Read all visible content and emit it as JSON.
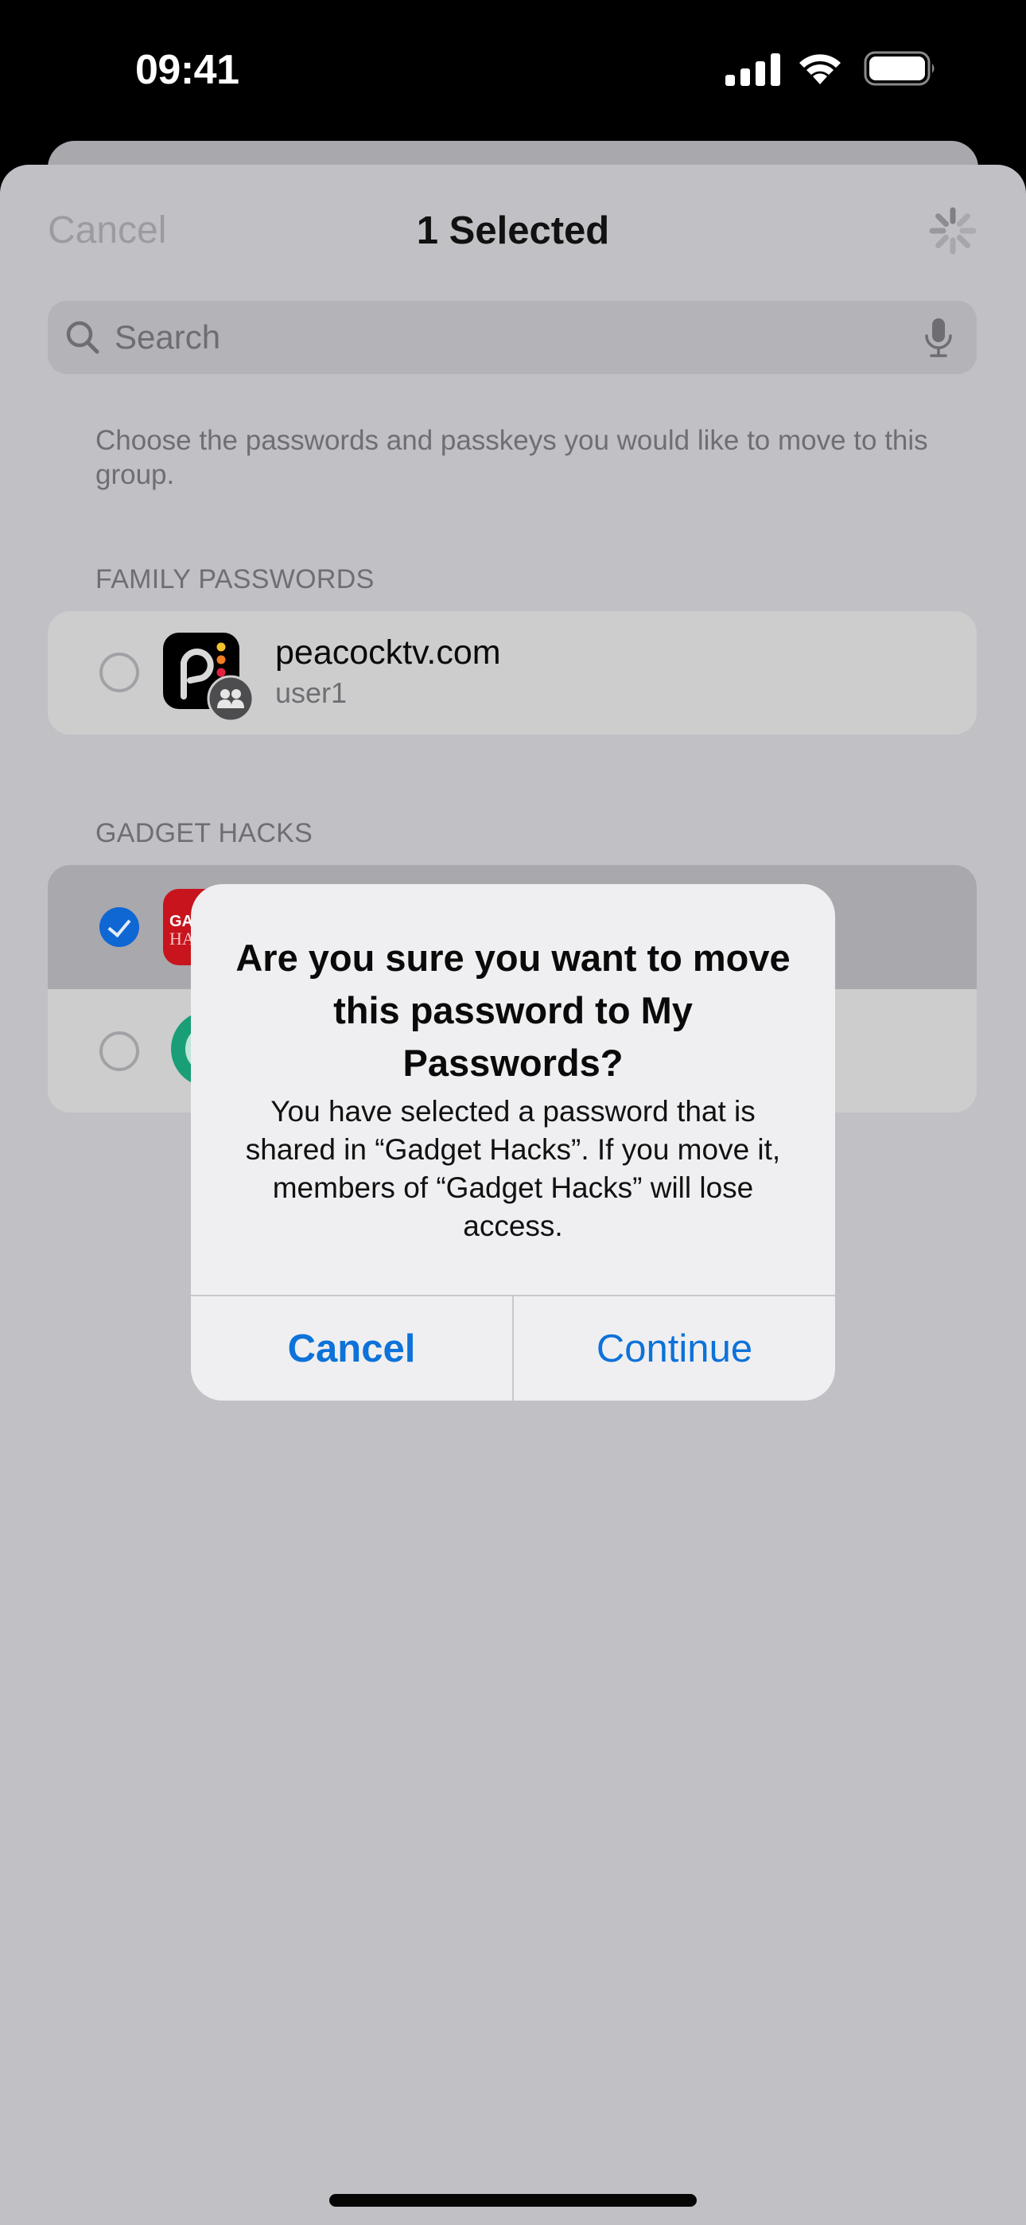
{
  "status_bar": {
    "time": "09:41",
    "icons": [
      "cellular-signal-icon",
      "wifi-icon",
      "battery-icon"
    ]
  },
  "nav": {
    "cancel_label": "Cancel",
    "title": "1 Selected",
    "activity_icon": "loading-spinner-icon"
  },
  "search": {
    "placeholder": "Search",
    "value": "",
    "icon": "search-icon",
    "mic_icon": "microphone-icon"
  },
  "description": "Choose the passwords and passkeys you would like to move to this group.",
  "sections": [
    {
      "header": "FAMILY PASSWORDS",
      "items": [
        {
          "title": "peacocktv.com",
          "subtitle": "user1",
          "selected": false,
          "icon": "peacock-app-icon",
          "badge": "shared-group-icon"
        }
      ]
    },
    {
      "header": "GADGET HACKS",
      "items": [
        {
          "title": "",
          "subtitle": "",
          "selected": true,
          "icon": "gadget-hacks-app-icon",
          "icon_text": [
            "GA",
            "HA"
          ]
        },
        {
          "title": "",
          "subtitle": "",
          "selected": false,
          "icon": "green-circle-app-icon"
        }
      ]
    }
  ],
  "alert": {
    "title": "Are you sure you want to move this password to My Passwords?",
    "message": "You have selected a password that is shared in “Gadget Hacks”. If you move it, members of “Gadget Hacks” will lose access.",
    "cancel_label": "Cancel",
    "continue_label": "Continue"
  },
  "colors": {
    "accent": "#0d72d9",
    "checkbox_selected": "#0f67d4",
    "peacock_dots": [
      "#f5c22c",
      "#ef7f22",
      "#e0223f",
      "#6b4fd8"
    ],
    "gadget_hacks_red": "#c8141c",
    "green_icon": "#1a9e77"
  }
}
